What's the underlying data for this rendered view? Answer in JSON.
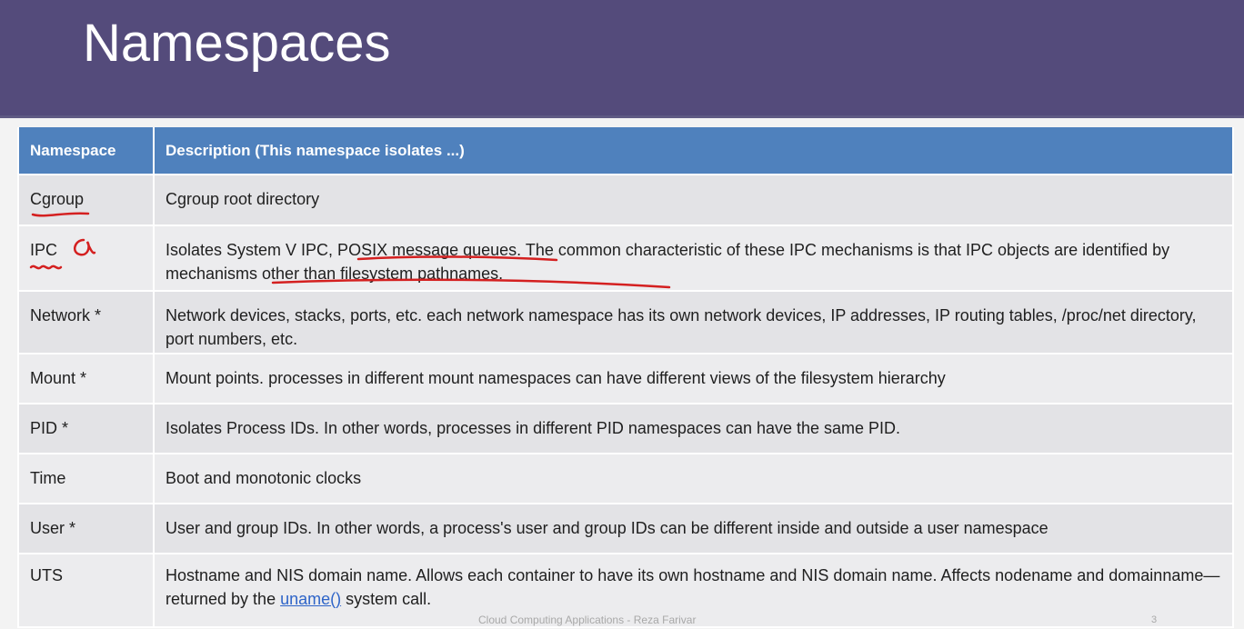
{
  "title": "Namespaces",
  "table": {
    "headers": [
      "Namespace",
      "Description (This namespace isolates ...)"
    ],
    "rows": [
      {
        "name": "Cgroup",
        "description": "Cgroup root directory"
      },
      {
        "name": "IPC",
        "description": "Isolates System V IPC, POSIX message queues. The common characteristic of these IPC mechanisms is that IPC objects are identified by mechanisms other than filesystem pathnames."
      },
      {
        "name": "Network *",
        "description": "Network devices, stacks, ports, etc. each network namespace has its own network devices, IP addresses, IP routing tables, /proc/net directory, port numbers, etc."
      },
      {
        "name": "Mount *",
        "description": "Mount points. processes in different mount namespaces can have different views of the filesystem hierarchy"
      },
      {
        "name": "PID *",
        "description": "Isolates Process IDs. In other words, processes in different PID namespaces can have the same PID."
      },
      {
        "name": "Time",
        "description": "Boot and monotonic clocks"
      },
      {
        "name": "User *",
        "description": "User and group IDs. In other words, a process's user and group IDs can be different inside and outside a user namespace"
      },
      {
        "name": "UTS",
        "description_before": "Hostname and NIS domain name. Allows each container to have its own hostname and NIS domain name. Affects nodename and domainname—returned by the ",
        "description_link": "uname()",
        "description_after": " system call."
      }
    ]
  },
  "footer": {
    "text": "Cloud Computing Applications - Reza Farivar",
    "page_number": "3"
  },
  "colors": {
    "title_bar": "#544b7b",
    "header_row": "#4f81bd",
    "ink": "#d42020"
  }
}
